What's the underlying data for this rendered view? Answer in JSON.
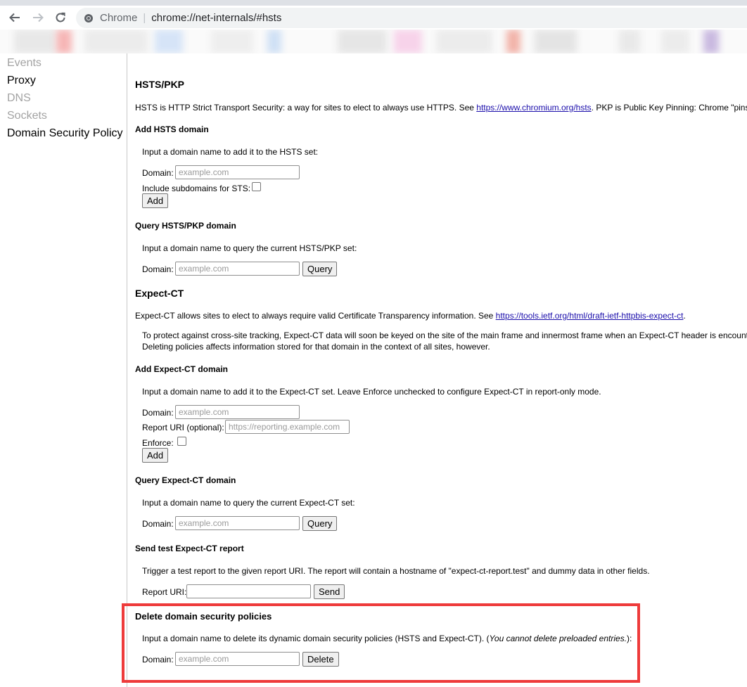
{
  "browser": {
    "chip_label": "Chrome",
    "separator": "|",
    "url": "chrome://net-internals/#hsts"
  },
  "sidebar": {
    "items": [
      {
        "label": "Events"
      },
      {
        "label": "Proxy"
      },
      {
        "label": "DNS"
      },
      {
        "label": "Sockets"
      },
      {
        "label": "Domain Security Policy"
      }
    ]
  },
  "hsts": {
    "title": "HSTS/PKP",
    "desc_before": "HSTS is HTTP Strict Transport Security: a way for sites to elect to always use HTTPS. See ",
    "desc_link": "https://www.chromium.org/hsts",
    "desc_after": ". PKP is Public Key Pinning: Chrome \"pins\" cer",
    "add": {
      "title": "Add HSTS domain",
      "desc": "Input a domain name to add it to the HSTS set:",
      "domain_label": "Domain:",
      "domain_placeholder": "example.com",
      "subdomains_label": "Include subdomains for STS:",
      "button": "Add"
    },
    "query": {
      "title": "Query HSTS/PKP domain",
      "desc": "Input a domain name to query the current HSTS/PKP set:",
      "domain_label": "Domain:",
      "domain_placeholder": "example.com",
      "button": "Query"
    }
  },
  "expect_ct": {
    "title": "Expect-CT",
    "desc_before": "Expect-CT allows sites to elect to always require valid Certificate Transparency information. See ",
    "desc_link": "https://tools.ietf.org/html/draft-ietf-httpbis-expect-ct",
    "desc_after": ".",
    "note_line1": "To protect against cross-site tracking, Expect-CT data will soon be keyed on the site of the main frame and innermost frame when an Expect-CT header is encounte",
    "note_line2": "Deleting policies affects information stored for that domain in the context of all sites, however.",
    "add": {
      "title": "Add Expect-CT domain",
      "desc": "Input a domain name to add it to the Expect-CT set. Leave Enforce unchecked to configure Expect-CT in report-only mode.",
      "domain_label": "Domain:",
      "domain_placeholder": "example.com",
      "report_label": "Report URI (optional):",
      "report_placeholder": "https://reporting.example.com",
      "enforce_label": "Enforce:",
      "button": "Add"
    },
    "query": {
      "title": "Query Expect-CT domain",
      "desc": "Input a domain name to query the current Expect-CT set:",
      "domain_label": "Domain:",
      "domain_placeholder": "example.com",
      "button": "Query"
    },
    "test": {
      "title": "Send test Expect-CT report",
      "desc": "Trigger a test report to the given report URI. The report will contain a hostname of \"expect-ct-report.test\" and dummy data in other fields.",
      "uri_label": "Report URI:",
      "button": "Send"
    }
  },
  "delete": {
    "title": "Delete domain security policies",
    "desc_before": "Input a domain name to delete its dynamic domain security policies (HSTS and Expect-CT). (",
    "desc_italic": "You cannot delete preloaded entries.",
    "desc_after": "):",
    "domain_label": "Domain:",
    "domain_placeholder": "example.com",
    "button": "Delete"
  },
  "colors": {
    "highlight": "#ee3b3b",
    "link": "#1a0dab",
    "omnibox_bg": "#f1f3f4"
  }
}
